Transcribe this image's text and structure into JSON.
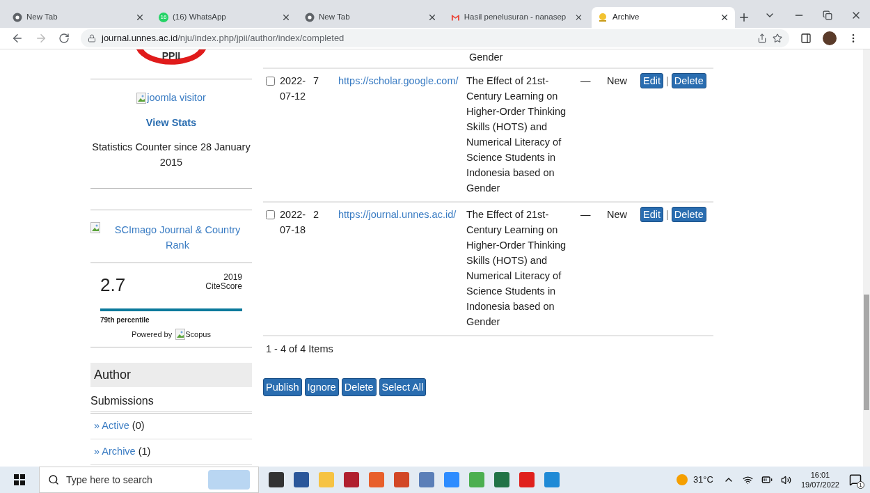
{
  "browser": {
    "tabs": [
      {
        "title": "New Tab",
        "kind": "chrome",
        "selected": false
      },
      {
        "title": "(16) WhatsApp",
        "kind": "whatsapp",
        "badge": "16",
        "selected": false
      },
      {
        "title": "New Tab",
        "kind": "chrome",
        "selected": false
      },
      {
        "title": "Hasil penelusuran - nanasep",
        "kind": "mail",
        "selected": false
      },
      {
        "title": "Archive",
        "kind": "journal",
        "selected": true
      }
    ],
    "url_host": "journal.unnes.ac.id",
    "url_path": "/nju/index.php/jpii/author/index/completed"
  },
  "sidebar": {
    "logo_text": "PPII",
    "visitor_image_alt": "joomla visitor",
    "view_stats": "View Stats",
    "counter_text": "Statistics Counter since 28 January 2015",
    "scimago_link": "SCImago Journal & Country Rank",
    "citescore": {
      "value": "2.7",
      "year": "2019",
      "label": "CiteScore",
      "percentile": "79th percentile",
      "powered_by": "Powered by",
      "scopus_alt": "Scopus"
    },
    "heading": "Author",
    "subheading": "Submissions",
    "links": [
      {
        "arrow": "»",
        "label": "Active",
        "count": "(0)"
      },
      {
        "arrow": "»",
        "label": "Archive",
        "count": "(1)"
      }
    ]
  },
  "table": {
    "partial_row": {
      "title": "Gender"
    },
    "rows": [
      {
        "checked": false,
        "date": "2022-07-12",
        "column_3": "7",
        "url": "https://scholar.google.com/",
        "title": "The Effect of 21st-Century Learning on Higher-Order Thinking Skills (HOTS) and Numerical Literacy of Science Students in Indonesia based on Gender",
        "column_6": "—",
        "status": "New",
        "edit": "Edit",
        "separator": "|",
        "delete": "Delete"
      },
      {
        "checked": false,
        "date": "2022-07-18",
        "column_3": "2",
        "url": "https://journal.unnes.ac.id/",
        "title": "The Effect of 21st-Century Learning on Higher-Order Thinking Skills (HOTS) and Numerical Literacy of Science Students in Indonesia based on Gender",
        "column_6": "—",
        "status": "New",
        "edit": "Edit",
        "separator": "|",
        "delete": "Delete"
      }
    ],
    "pager": "1 - 4 of 4 Items",
    "buttons": [
      "Publish",
      "Ignore",
      "Delete",
      "Select All"
    ]
  },
  "taskbar": {
    "search_placeholder": "Type here to search",
    "weather": "31°C",
    "time": "16:01",
    "date": "19/07/2022",
    "notification_count": "1"
  }
}
